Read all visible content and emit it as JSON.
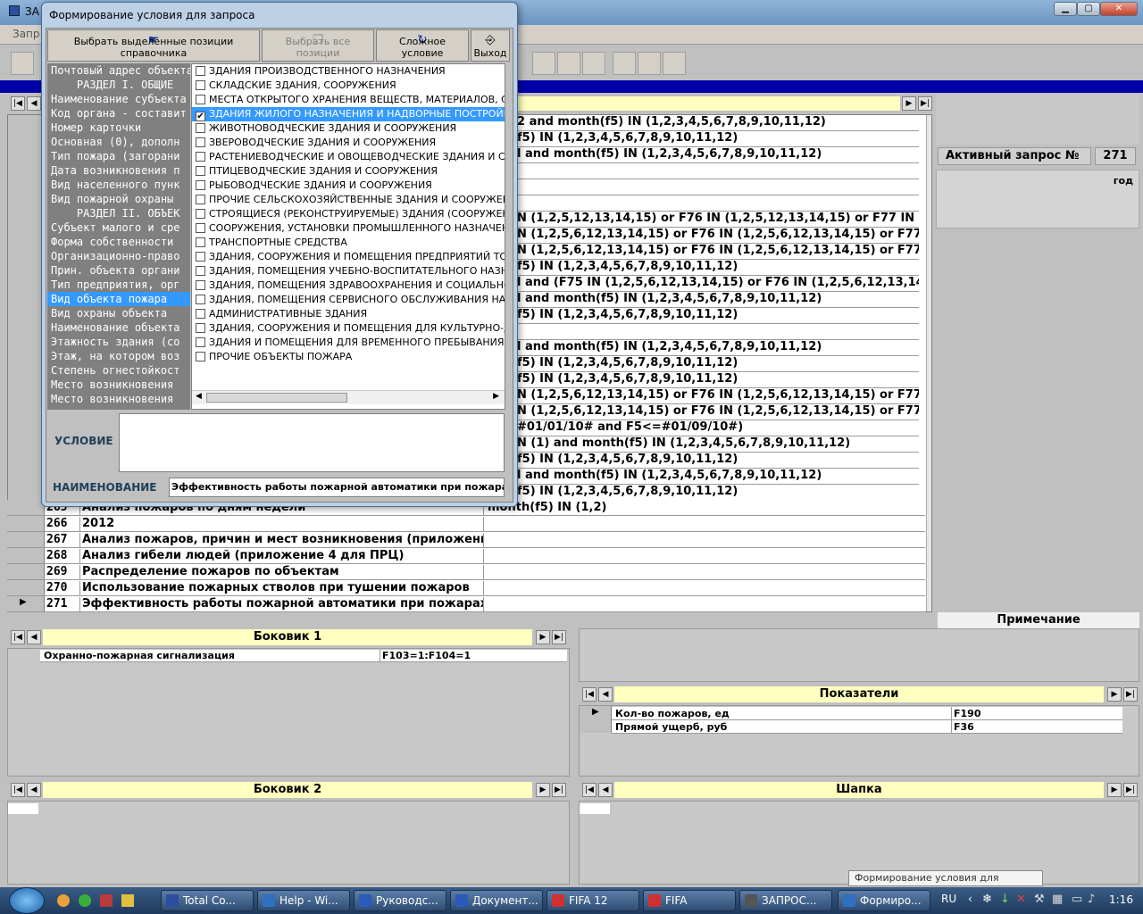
{
  "window": {
    "title": "ЗА",
    "menu": "Запр"
  },
  "active_query": {
    "label": "Активный запрос №",
    "value": "271"
  },
  "right_panel": {
    "god_label": "год",
    "note_label": "Примечание"
  },
  "conditions": [
    "2 and month(f5) IN (1,2,3,4,5,6,7,8,9,10,11,12)",
    "f5) IN (1,2,3,4,5,6,7,8,9,10,11,12)",
    "l and month(f5) IN (1,2,3,4,5,6,7,8,9,10,11,12)",
    "",
    "",
    "",
    "N (1,2,5,12,13,14,15) or F76 IN (1,2,5,12,13,14,15) or F77 IN (1,2,5,12",
    "N (1,2,5,6,12,13,14,15) or F76 IN (1,2,5,6,12,13,14,15) or F77 IN (1,2,",
    "N (1,2,5,6,12,13,14,15) or F76 IN (1,2,5,6,12,13,14,15) or F77 IN (1,2,5",
    "f5) IN (1,2,3,4,5,6,7,8,9,10,11,12)",
    "l and (F75 IN (1,2,5,6,12,13,14,15) or F76 IN (1,2,5,6,12,13,14,15) or",
    "l and month(f5) IN (1,2,3,4,5,6,7,8,9,10,11,12)",
    "f5) IN (1,2,3,4,5,6,7,8,9,10,11,12)",
    "",
    "l and month(f5) IN (1,2,3,4,5,6,7,8,9,10,11,12)",
    "f5) IN (1,2,3,4,5,6,7,8,9,10,11,12)",
    "f5) IN (1,2,3,4,5,6,7,8,9,10,11,12)",
    "N (1,2,5,6,12,13,14,15) or F76 IN (1,2,5,6,12,13,14,15) or F77 IN (1,2,",
    "N (1,2,5,6,12,13,14,15) or F76 IN (1,2,5,6,12,13,14,15) or F77 IN (1,2,",
    "#01/01/10# and F5<=#01/09/10#)",
    "N (1) and month(f5) IN (1,2,3,4,5,6,7,8,9,10,11,12)",
    "f5) IN (1,2,3,4,5,6,7,8,9,10,11,12)",
    "l and month(f5) IN (1,2,3,4,5,6,7,8,9,10,11,12)",
    "f5) IN (1,2,3,4,5,6,7,8,9,10,11,12)"
  ],
  "rows": [
    {
      "id": "265",
      "name": "Анализ пожаров по дням недели",
      "cond": "month(f5) IN (1,2)"
    },
    {
      "id": "266",
      "name": "2012",
      "cond": ""
    },
    {
      "id": "267",
      "name": "Анализ пожаров, причин и мест возникновения (приложени",
      "cond": ""
    },
    {
      "id": "268",
      "name": "Анализ гибели людей (приложение 4 для ПРЦ)",
      "cond": ""
    },
    {
      "id": "269",
      "name": "Распределение пожаров по объектам",
      "cond": ""
    },
    {
      "id": "270",
      "name": "Использование пожарных стволов при тушении пожаров",
      "cond": ""
    },
    {
      "id": "271",
      "name": "Эффективность работы пожарной автоматики при пожарах",
      "cond": ""
    }
  ],
  "dialog": {
    "title": "Формирование условия для запроса",
    "btn_select": "Выбрать выделенные позиции справочника",
    "btn_select_all": "Выбрать все позиции",
    "btn_complex": "Сложное условие",
    "btn_exit": "Выход",
    "cond_label": "УСЛОВИЕ",
    "cond_value": "",
    "name_label": "НАИМЕНОВАНИЕ",
    "name_value": "Эффективность работы пожарной автоматики при пожарах в",
    "fields": [
      "Почтовый адрес объекта",
      "    РАЗДЕЛ I. ОБЩИЕ",
      "Наименование субъекта",
      "Код органа - составит",
      "Номер карточки",
      "Основная (0), дополн",
      "Тип пожара (загорани",
      "Дата возникновения п",
      "Вид населенного пунк",
      "Вид пожарной охраны",
      "    РАЗДЕЛ II. ОБЪЕК",
      "Субъект малого и сре",
      "Форма собственности",
      "Организационно-право",
      "Прин. объекта органи",
      "Тип предприятия, орг",
      "Вид объекта пожара",
      "Вид охраны объекта",
      "Наименование объекта",
      "Этажность здания (со",
      "Этаж, на котором воз",
      "Степень огнестойкост",
      "Место возникновения",
      "Место возникновения"
    ],
    "options": [
      {
        "label": "ЗДАНИЯ ПРОИЗВОДСТВЕННОГО НАЗНАЧЕНИЯ",
        "checked": false
      },
      {
        "label": "СКЛАДСКИЕ ЗДАНИЯ, СООРУЖЕНИЯ",
        "checked": false
      },
      {
        "label": "МЕСТА ОТКРЫТОГО ХРАНЕНИЯ ВЕЩЕСТВ, МАТЕРИАЛОВ, С/Х",
        "checked": false
      },
      {
        "label": "ЗДАНИЯ ЖИЛОГО НАЗНАЧЕНИЯ И НАДВОРНЫЕ ПОСТРОЙКИ",
        "checked": true
      },
      {
        "label": "ЖИВОТНОВОДЧЕСКИЕ ЗДАНИЯ И СООРУЖЕНИЯ",
        "checked": false
      },
      {
        "label": "ЗВЕРОВОДЧЕСКИЕ ЗДАНИЯ И СООРУЖЕНИЯ",
        "checked": false
      },
      {
        "label": "РАСТЕНИЕВОДЧЕСКИЕ И ОВОЩЕВОДЧЕСКИЕ ЗДАНИЯ И СОО",
        "checked": false
      },
      {
        "label": "ПТИЦЕВОДЧЕСКИЕ ЗДАНИЯ И СООРУЖЕНИЯ",
        "checked": false
      },
      {
        "label": "РЫБОВОДЧЕСКИЕ ЗДАНИЯ И СООРУЖЕНИЯ",
        "checked": false
      },
      {
        "label": "ПРОЧИЕ СЕЛЬСКОХОЗЯЙСТВЕННЫЕ ЗДАНИЯ И СООРУЖЕНИ",
        "checked": false
      },
      {
        "label": "СТРОЯЩИЕСЯ (РЕКОНСТРУИРУЕМЫЕ) ЗДАНИЯ (СООРУЖЕН",
        "checked": false
      },
      {
        "label": "СООРУЖЕНИЯ, УСТАНОВКИ ПРОМЫШЛЕННОГО НАЗНАЧЕНИ",
        "checked": false
      },
      {
        "label": "ТРАНСПОРТНЫЕ СРЕДСТВА",
        "checked": false
      },
      {
        "label": "ЗДАНИЯ, СООРУЖЕНИЯ И ПОМЕЩЕНИЯ ПРЕДПРИЯТИЙ ТОР",
        "checked": false
      },
      {
        "label": "ЗДАНИЯ, ПОМЕЩЕНИЯ УЧЕБНО-ВОСПИТАТЕЛЬНОГО НАЗНАЧ",
        "checked": false
      },
      {
        "label": "ЗДАНИЯ, ПОМЕЩЕНИЯ ЗДРАВООХРАНЕНИЯ И СОЦИАЛЬНОГ",
        "checked": false
      },
      {
        "label": "ЗДАНИЯ, ПОМЕЩЕНИЯ СЕРВИСНОГО ОБСЛУЖИВАНИЯ НАСЕ",
        "checked": false
      },
      {
        "label": "АДМИНИСТРАТИВНЫЕ ЗДАНИЯ",
        "checked": false
      },
      {
        "label": "ЗДАНИЯ, СООРУЖЕНИЯ И ПОМЕЩЕНИЯ ДЛЯ КУЛЬТУРНО-Д",
        "checked": false
      },
      {
        "label": "ЗДАНИЯ И ПОМЕЩЕНИЯ ДЛЯ ВРЕМЕННОГО ПРЕБЫВАНИЯ (Г",
        "checked": false
      },
      {
        "label": "ПРОЧИЕ ОБЪЕКТЫ ПОЖАРА",
        "checked": false
      }
    ]
  },
  "bokovik1": {
    "title": "Боковик 1",
    "row_name": "Охранно-пожарная сигнализация",
    "row_cond": "F103=1:F104=1"
  },
  "bokovik2": {
    "title": "Боковик 2"
  },
  "pokazateli": {
    "title": "Показатели",
    "rows": [
      {
        "name": "Кол-во пожаров, ед",
        "field": "F190"
      },
      {
        "name": "Прямой ущерб, руб",
        "field": "F36"
      }
    ]
  },
  "shapka": {
    "title": "Шапка"
  },
  "tooltip": "Формирование условия для запроса",
  "taskbar": {
    "tasks": [
      "Total Co...",
      "Help - Wi...",
      "Руководс...",
      "Документ...",
      "FIFA 12",
      "FIFA",
      "ЗАПРОС...",
      "Формиро..."
    ],
    "lang": "RU",
    "time": "1:16"
  }
}
